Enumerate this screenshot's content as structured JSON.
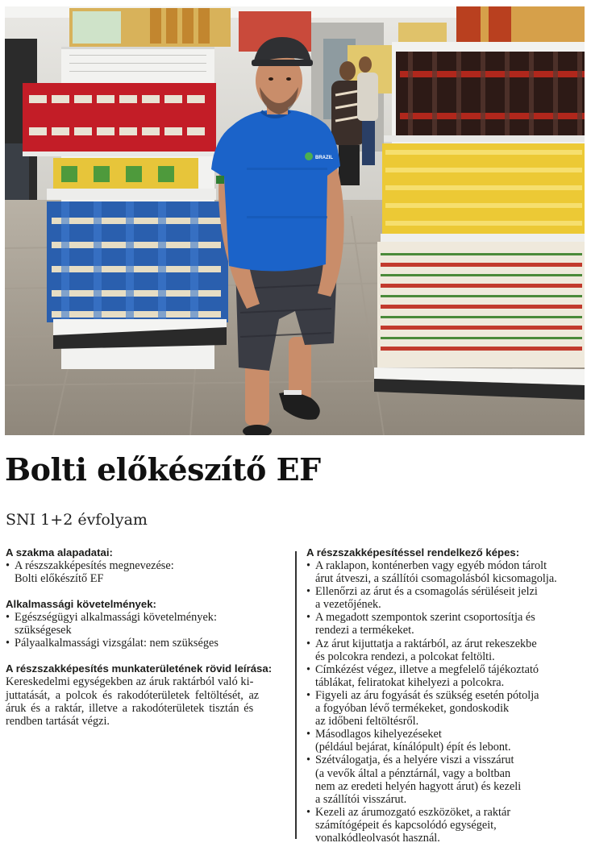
{
  "title": "Bolti előkészítő EF",
  "subtitle": "SNI 1+2 évfolyam",
  "photo": {
    "shirt_logo_text": "BRAZIL"
  },
  "left": {
    "basics": {
      "heading": "A szakma alapadatai:",
      "item_label": "A részszakképesítés megnevezése:",
      "item_value": "Bolti előkészítő EF"
    },
    "requirements": {
      "heading": "Alkalmassági követelmények:",
      "items": [
        [
          "Egészségügyi alkalmassági követelmények:",
          "szükségesek"
        ],
        [
          "Pályaalkalmassági vizsgálat: nem szükséges"
        ]
      ]
    },
    "description": {
      "heading": "A részszakképesítés munkaterületének rövid leírása:",
      "lines": [
        "Kereskedelmi egységekben az áruk raktárból való ki-",
        "juttatását, a polcok és rakodóterületek feltöltését, az",
        "áruk és a raktár, illetve a rakodóterületek tisztán és",
        "rendben tartását végzi."
      ]
    }
  },
  "right": {
    "heading": "A részszakképesítéssel rendelkező képes:",
    "items": [
      [
        "A raklapon, konténerben vagy egyéb módon tárolt",
        "árut átveszi, a szállítói csomagolásból kicsomagolja."
      ],
      [
        "Ellenőrzi az árut és a csomagolás sérüléseit jelzi",
        "a vezetőjének."
      ],
      [
        "A megadott szempontok szerint csoportosítja és",
        "rendezi a termékeket."
      ],
      [
        "Az árut kijuttatja a raktárból, az árut rekeszekbe",
        "és polcokra rendezi, a polcokat feltölti."
      ],
      [
        "Címkézést végez, illetve a megfelelő tájékoztató",
        "táblákat, feliratokat kihelyezi a polcokra."
      ],
      [
        "Figyeli az áru fogyását és szükség esetén pótolja",
        "a fogyóban lévő termékeket, gondoskodik",
        "az időbeni feltöltésről."
      ],
      [
        "Másodlagos kihelyezéseket",
        "(például bejárat, kínálópult) épít és lebont."
      ],
      [
        "Szétválogatja, és a helyére viszi a visszárut",
        "(a vevők által a pénztárnál, vagy a boltban",
        "nem az eredeti helyén hagyott árut) és kezeli",
        "a szállítói visszárut."
      ],
      [
        "Kezeli az árumozgató eszközöket, a raktár",
        "számítógépeit és kapcsolódó egységeit,",
        "vonalkódleolvasót használ."
      ]
    ]
  }
}
